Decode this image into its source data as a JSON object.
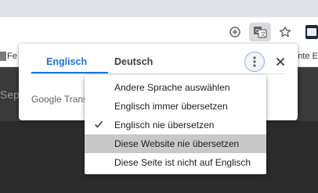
{
  "toolbar": {
    "icons": [
      "add-circle-icon",
      "translate-icon",
      "star-icon",
      "extension-icon"
    ]
  },
  "bookmarks": {
    "left_label": "Fe",
    "right_label": "nte E"
  },
  "page": {
    "visible_text": "Sep"
  },
  "translate_bubble": {
    "tabs": [
      {
        "label": "Englisch",
        "active": true
      },
      {
        "label": "Deutsch",
        "active": false
      }
    ],
    "powered_by": "Google Transl",
    "colors": {
      "accent": "#1a73e8",
      "highlight": "#c8c8c8"
    }
  },
  "options_menu": {
    "items": [
      {
        "label": "Andere Sprache auswählen",
        "checked": false,
        "highlighted": false
      },
      {
        "label": "Englisch immer übersetzen",
        "checked": false,
        "highlighted": false
      },
      {
        "label": "Englisch nie übersetzen",
        "checked": true,
        "highlighted": false
      },
      {
        "label": "Diese Website nie übersetzen",
        "checked": false,
        "highlighted": true
      },
      {
        "label": "Diese Seite ist nicht auf Englisch",
        "checked": false,
        "highlighted": false
      }
    ]
  }
}
